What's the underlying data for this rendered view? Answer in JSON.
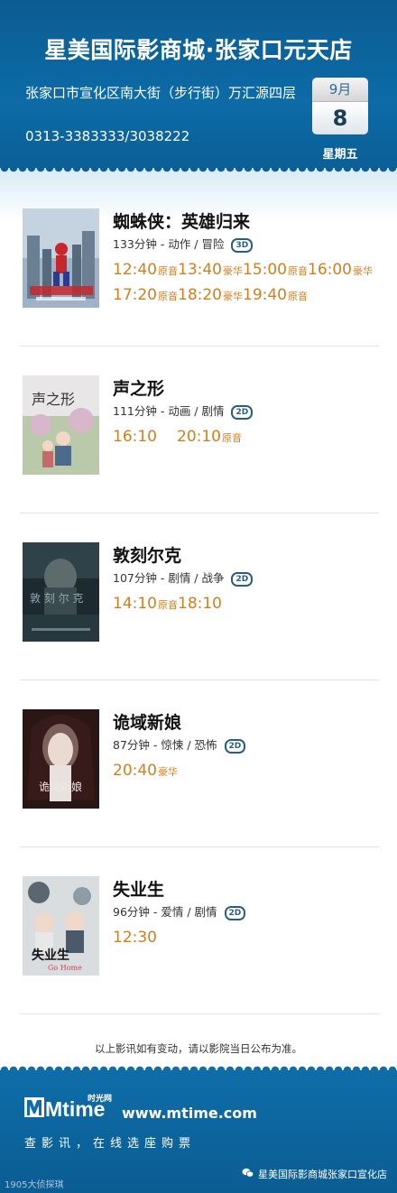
{
  "header": {
    "title": "星美国际影商城·张家口元天店",
    "address": "张家口市宣化区南大街（步行街）万汇源四层",
    "phone": "0313-3383333/3038222",
    "month": "9月",
    "day": "8",
    "weekday": "星期五"
  },
  "movies": [
    {
      "name": "蜘蛛侠：英雄归来",
      "meta": "133分钟 - 动作 / 冒险",
      "format": "3D",
      "poster": "spider-man-poster",
      "line1": [
        {
          "t": "12:40",
          "tag": "原音"
        },
        {
          "t": "13:40",
          "tag": "豪华"
        },
        {
          "t": "15:00",
          "tag": "原音"
        },
        {
          "t": "16:00",
          "tag": "豪华"
        }
      ],
      "line2": [
        {
          "t": "17:20",
          "tag": "原音"
        },
        {
          "t": "18:20",
          "tag": "豪华"
        },
        {
          "t": "19:40",
          "tag": "原音"
        }
      ]
    },
    {
      "name": "声之形",
      "meta": "111分钟 - 动画 / 剧情",
      "format": "2D",
      "poster": "silent-voice-poster",
      "line1": [
        {
          "t": "16:10",
          "tag": ""
        },
        {
          "t": "20:10",
          "tag": "原音"
        }
      ],
      "line2": []
    },
    {
      "name": "敦刻尔克",
      "meta": "107分钟 - 剧情 / 战争",
      "format": "2D",
      "poster": "dunkirk-poster",
      "line1": [
        {
          "t": "14:10",
          "tag": "原音"
        },
        {
          "t": "18:10",
          "tag": ""
        }
      ],
      "line2": []
    },
    {
      "name": "诡域新娘",
      "meta": "87分钟 - 惊悚 / 恐怖",
      "format": "2D",
      "poster": "bride-poster",
      "line1": [
        {
          "t": "20:40",
          "tag": "豪华"
        }
      ],
      "line2": []
    },
    {
      "name": "失业生",
      "meta": "96分钟 - 爱情 / 剧情",
      "format": "2D",
      "poster": "graduate-poster",
      "line1": [
        {
          "t": "12:30",
          "tag": ""
        }
      ],
      "line2": []
    }
  ],
  "notice": "以上影讯如有变动，请以影院当日公布为准。",
  "footer": {
    "logo_text": "Mtime",
    "logo_cn": "时光网",
    "site": "www.mtime.com",
    "slogan": "查影讯，在线选座购票",
    "wechat": "星美国际影商城张家口宣化店",
    "watermark": "1905大侦探琪"
  },
  "colors": {
    "header_blue": "#0b5c92",
    "time_orange": "#d47d1b",
    "badge_blue": "#2a5e80"
  }
}
